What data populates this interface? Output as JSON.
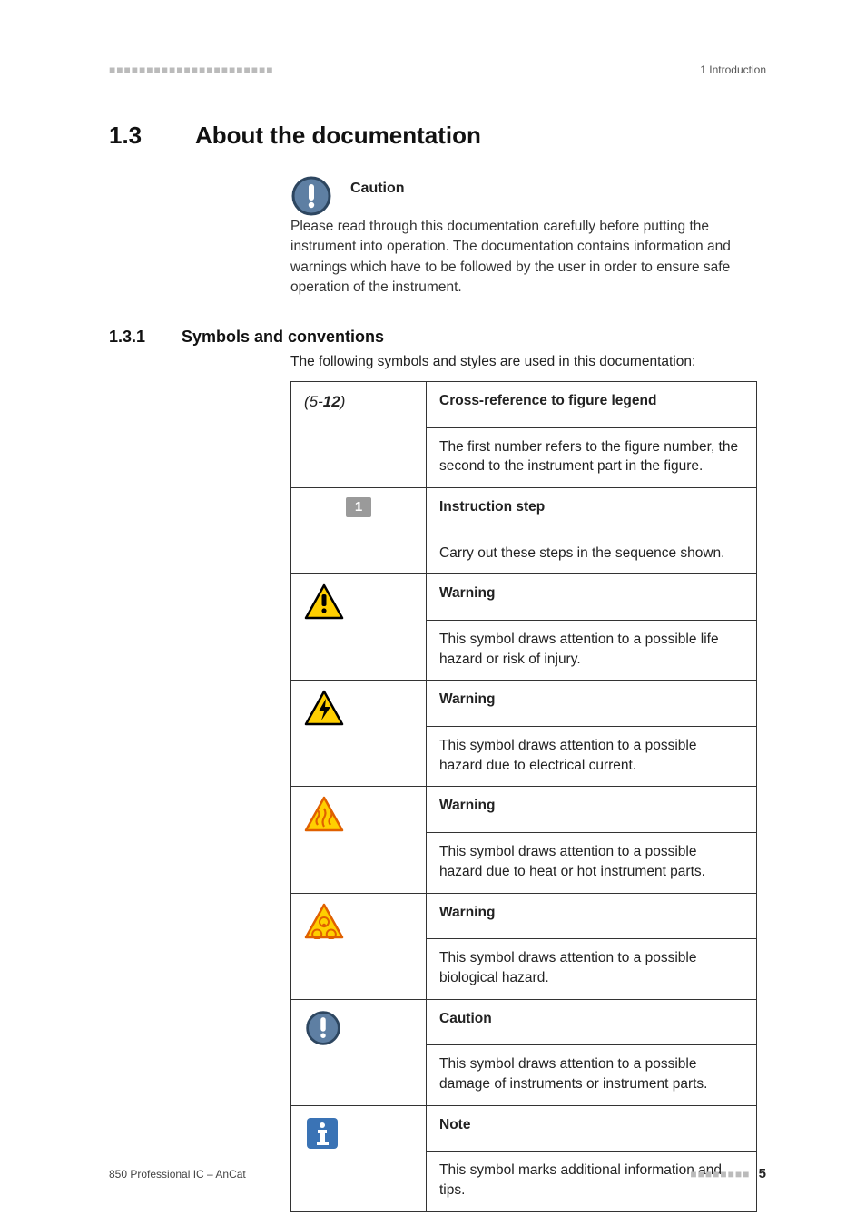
{
  "header": {
    "dashes": "■■■■■■■■■■■■■■■■■■■■■■",
    "chapter": "1 Introduction"
  },
  "section": {
    "number": "1.3",
    "title": "About the documentation"
  },
  "caution_box": {
    "title": "Caution",
    "text": "Please read through this documentation carefully before putting the instrument into operation. The documentation contains information and warnings which have to be followed by the user in order to ensure safe operation of the instrument."
  },
  "subsection": {
    "number": "1.3.1",
    "title": "Symbols and conventions",
    "intro": "The following symbols and styles are used in this documentation:"
  },
  "rows": {
    "crossref": {
      "symbol_prefix": "(5-",
      "symbol_bold": "12",
      "symbol_suffix": ")",
      "title": "Cross-reference to figure legend",
      "desc": "The first number refers to the figure number, the second to the instrument part in the figure."
    },
    "step": {
      "symbol": "1",
      "title": "Instruction step",
      "desc": "Carry out these steps in the sequence shown."
    },
    "warn_life": {
      "title": "Warning",
      "desc": "This symbol draws attention to a possible life hazard or risk of injury."
    },
    "warn_elec": {
      "title": "Warning",
      "desc": "This symbol draws attention to a possible hazard due to electrical current."
    },
    "warn_heat": {
      "title": "Warning",
      "desc": "This symbol draws attention to a possible hazard due to heat or hot instrument parts."
    },
    "warn_bio": {
      "title": "Warning",
      "desc": "This symbol draws attention to a possible biological hazard."
    },
    "caution": {
      "title": "Caution",
      "desc": "This symbol draws attention to a possible damage of instruments or instrument parts."
    },
    "note": {
      "title": "Note",
      "desc": "This symbol marks additional information and tips."
    }
  },
  "footer": {
    "product": "850 Professional IC – AnCat",
    "dashes": "■■■■■■■■",
    "page": "5"
  }
}
